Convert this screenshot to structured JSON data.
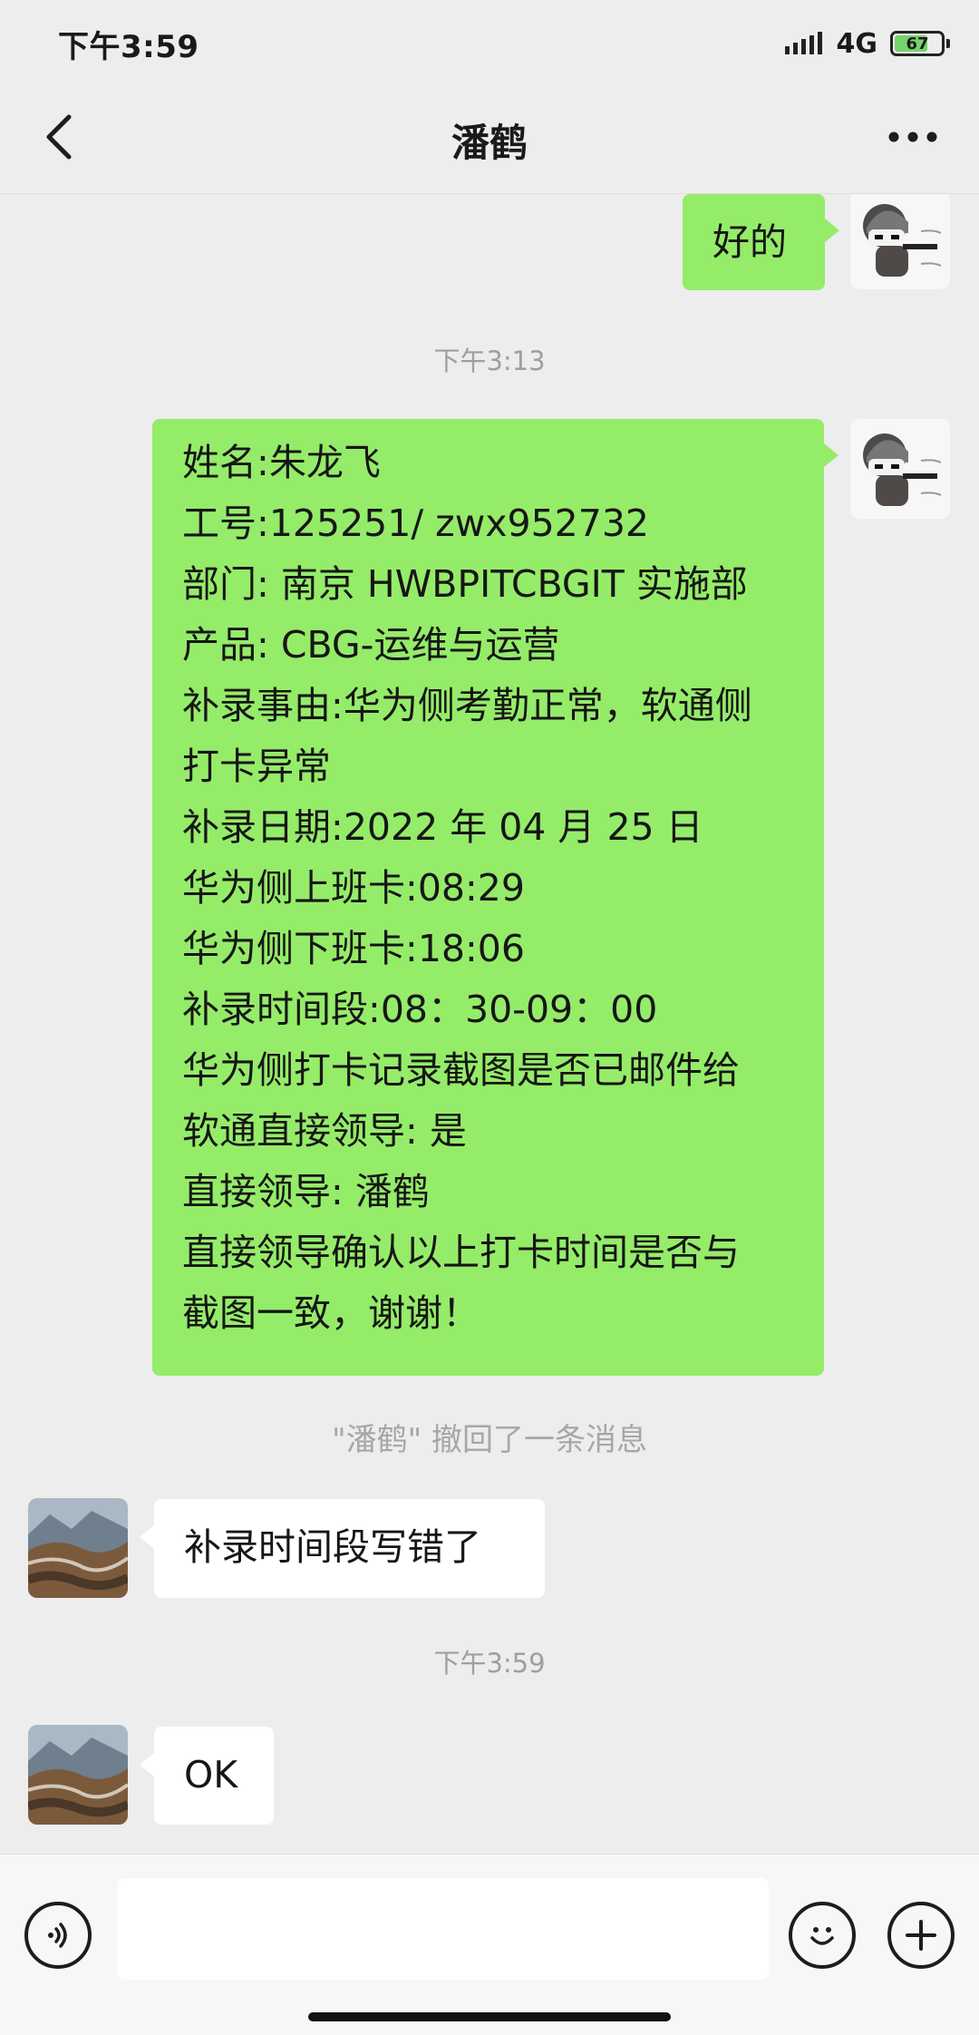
{
  "status_bar": {
    "time": "下午3:59",
    "network": "4G",
    "battery_level": "67"
  },
  "nav": {
    "title": "潘鹤"
  },
  "messages": {
    "top_reply": "好的",
    "timestamp_1": "下午3:13",
    "info_lines": [
      "姓名:朱龙飞",
      "工号:125251/ zwx952732",
      "部门: 南京 HWBPITCBGIT 实施部",
      "产品: CBG-运维与运营",
      "补录事由:华为侧考勤正常，软通侧",
      "打卡异常",
      "补录日期:2022 年 04 月 25 日",
      "华为侧上班卡:08:29",
      "华为侧下班卡:18:06",
      "补录时间段:08：30-09：00",
      "华为侧打卡记录截图是否已邮件给",
      "软通直接领导: 是",
      "直接领导: 潘鹤",
      "直接领导确认以上打卡时间是否与",
      "截图一致，谢谢！"
    ],
    "recall_notice": "\"潘鹤\" 撤回了一条消息",
    "other_message_1": "补录时间段写错了",
    "timestamp_2": "下午3:59",
    "other_message_2": "OK"
  },
  "icons": {
    "back": "chevron-left-icon",
    "more": "more-dots-icon",
    "voice": "voice-icon",
    "emoji": "emoji-icon",
    "plus": "plus-icon"
  },
  "colors": {
    "background": "#ededed",
    "sent_bubble": "#95ec69",
    "received_bubble": "#ffffff",
    "muted_text": "#9f9f9f"
  }
}
